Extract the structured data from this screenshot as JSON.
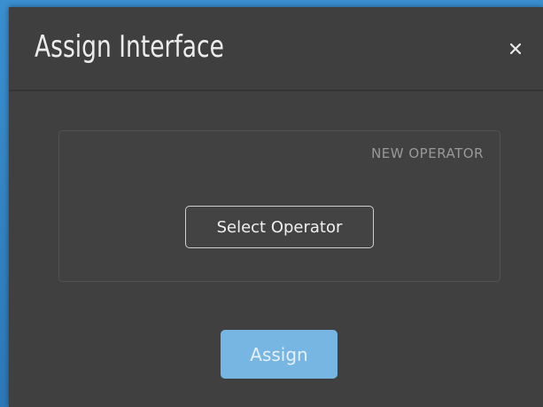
{
  "dialog": {
    "title": "Assign Interface",
    "close_icon": "close-icon"
  },
  "operator_panel": {
    "label": "NEW OPERATOR",
    "select_button_label": "Select Operator"
  },
  "actions": {
    "assign_label": "Assign",
    "assign_enabled": false
  },
  "colors": {
    "backdrop": "#2f7fc0",
    "dialog_background": "#404040",
    "assign_button": "#77b6e3"
  }
}
